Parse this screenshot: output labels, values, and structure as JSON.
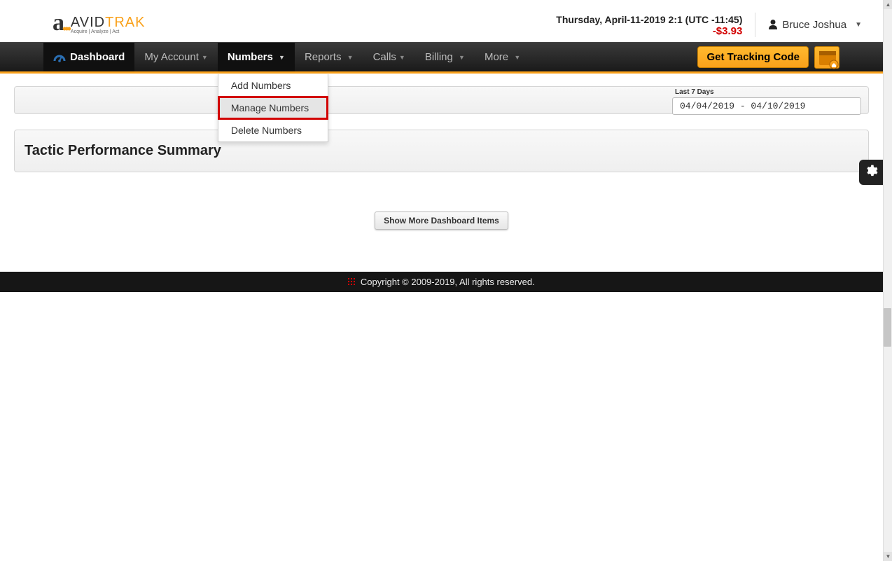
{
  "header": {
    "logo_brand_a": "AVID",
    "logo_brand_b": "TRAK",
    "logo_tag": "Acquire  |  Analyze  |  Act",
    "datetime": "Thursday, April-11-2019 2:1 (UTC -11:45)",
    "balance": "-$3.93",
    "user_name": "Bruce Joshua"
  },
  "nav": {
    "dashboard": "Dashboard",
    "my_account": "My Account",
    "numbers": "Numbers",
    "reports": "Reports",
    "calls": "Calls",
    "billing": "Billing",
    "more": "More",
    "tracking_code": "Get Tracking Code"
  },
  "numbers_dropdown": {
    "add": "Add Numbers",
    "manage": "Manage Numbers",
    "delete": "Delete Numbers"
  },
  "content": {
    "last7_label": "Last 7 Days",
    "date_range": "04/04/2019 - 04/10/2019",
    "section_title": "Tactic Performance Summary",
    "show_more": "Show More Dashboard Items"
  },
  "footer": {
    "copyright": "Copyright © 2009-2019, All rights reserved."
  }
}
